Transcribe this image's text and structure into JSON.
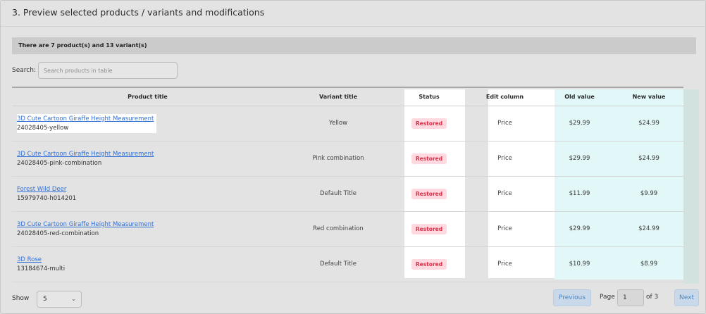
{
  "section": {
    "title": "3. Preview selected products / variants and modifications"
  },
  "summary": {
    "text": "There are 7 product(s) and 13 variant(s)"
  },
  "search": {
    "label": "Search:",
    "placeholder": "Search products in table"
  },
  "table": {
    "headers": {
      "product": "Product title",
      "variant": "Variant title",
      "status": "Status",
      "edit": "Edit column",
      "old": "Old value",
      "new": "New value"
    },
    "rows": [
      {
        "product": "3D Cute Cartoon Giraffe Height Measurement",
        "sku": "24028405-yellow",
        "variant": "Yellow",
        "status": "Restored",
        "edit": "Price",
        "old": "$29.99",
        "new": "$24.99"
      },
      {
        "product": "3D Cute Cartoon Giraffe Height Measurement",
        "sku": "24028405-pink-combination",
        "variant": "Pink combination",
        "status": "Restored",
        "edit": "Price",
        "old": "$29.99",
        "new": "$24.99"
      },
      {
        "product": "Forest Wild Deer",
        "sku": "15979740-h014201",
        "variant": "Default Title",
        "status": "Restored",
        "edit": "Price",
        "old": "$11.99",
        "new": "$9.99"
      },
      {
        "product": "3D Cute Cartoon Giraffe Height Measurement",
        "sku": "24028405-red-combination",
        "variant": "Red combination",
        "status": "Restored",
        "edit": "Price",
        "old": "$29.99",
        "new": "$24.99"
      },
      {
        "product": "3D Rose",
        "sku": "13184674-multi",
        "variant": "Default Title",
        "status": "Restored",
        "edit": "Price",
        "old": "$10.99",
        "new": "$8.99"
      }
    ]
  },
  "footer": {
    "show_label": "Show",
    "show_value": "5",
    "prev_label": "Previous",
    "page_label": "Page",
    "page_value": "1",
    "of_label": "of 3",
    "next_label": "Next"
  },
  "colors": {
    "link": "#2f6fd6",
    "badge_bg": "#ffd9df",
    "badge_text": "#d9304a",
    "value_column_bg": "#e2f7f7",
    "button_bg": "#c9d9ea"
  }
}
